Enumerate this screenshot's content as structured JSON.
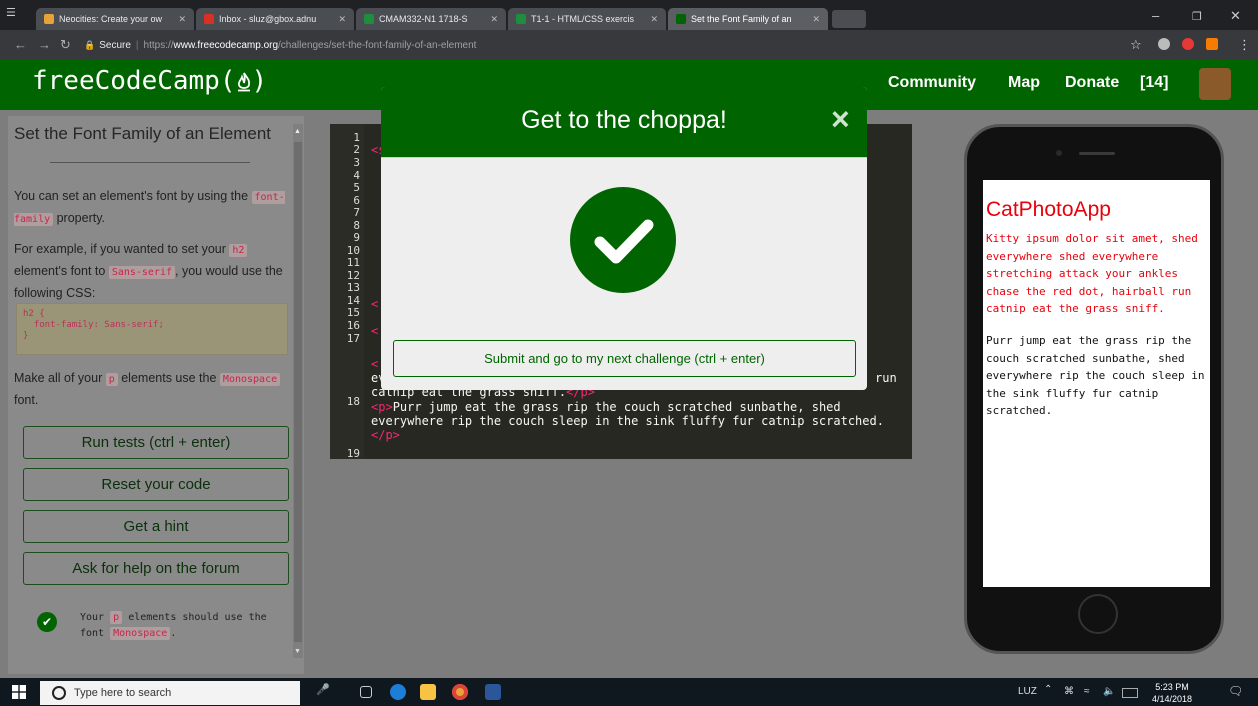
{
  "browser": {
    "tabs": [
      {
        "label": "Neocities: Create your ow",
        "favicon_color": "#e8a23a"
      },
      {
        "label": "Inbox - sluz@gbox.adnu",
        "favicon_color": "#d93025"
      },
      {
        "label": "CMAM332-N1 1718-S",
        "favicon_color": "#1e8e3e"
      },
      {
        "label": "T1-1 - HTML/CSS exercis",
        "favicon_color": "#1e8e3e"
      },
      {
        "label": "Set the Font Family of an",
        "favicon_color": "#006400"
      }
    ],
    "secure_label": "Secure",
    "url_scheme": "https://",
    "url_host": "www.freecodecamp.org",
    "url_path": "/challenges/set-the-font-family-of-an-element"
  },
  "navbar": {
    "logo": "freeCodeCamp(🔥)",
    "logo_text": "freeCodeCamp(",
    "logo_close": ")",
    "links": [
      "Community",
      "Map",
      "Donate"
    ],
    "points": "[14]"
  },
  "challenge": {
    "title": "Set the Font Family of an Element",
    "p1_before": "You can set an element's font by using the",
    "p1_code": "font-family",
    "p1_after": "property.",
    "p2_a": "For example, if you wanted to set your",
    "p2_code1": "h2",
    "p2_b": "element's font to",
    "p2_code2": "Sans-serif",
    "p2_c": ", you would use the following CSS:",
    "example_lines": [
      "h2 {",
      "  font-family: Sans-serif;",
      "}"
    ],
    "p3_a": "Make all of your",
    "p3_code1": "p",
    "p3_b": "elements use the",
    "p3_code2": "Monospace",
    "p3_c": "font.",
    "buttons": {
      "run": "Run tests (ctrl + enter)",
      "reset": "Reset your code",
      "hint": "Get a hint",
      "forum": "Ask for help on the forum"
    },
    "test_a": "Your",
    "test_code1": "p",
    "test_b": "elements should use the font",
    "test_code2": "Monospace",
    "test_c": "."
  },
  "editor": {
    "line_numbers": [
      "1",
      "2",
      "3",
      "4",
      "5",
      "6",
      "7",
      "8",
      "9",
      "10",
      "11",
      "12",
      "13",
      "14",
      "15",
      "16",
      "17",
      "18",
      "19"
    ],
    "line2_visible": "<s",
    "line13_visible": "<",
    "line15_visible": "<",
    "line17_visible": "<",
    "line17b_left": "ev",
    "line17b_right": "run",
    "line17c": "catnip eat the grass sniff.",
    "line17c_tag": "</p>",
    "line18_open": "<p>",
    "line18_text": "Purr jump eat the grass rip the couch scratched sunbathe, shed",
    "line18_text2": "everywhere rip the couch sleep in the sink fluffy fur catnip scratched.",
    "line18_close": "</p>"
  },
  "preview": {
    "title": "CatPhotoApp",
    "p1": "Kitty ipsum dolor sit amet, shed everywhere shed everywhere stretching attack your ankles chase the red dot, hairball run catnip eat the grass sniff.",
    "p2": "Purr jump eat the grass rip the couch scratched sunbathe, shed everywhere rip the couch sleep in the sink fluffy fur catnip scratched.",
    "p1_color": "#e8000b"
  },
  "modal": {
    "title": "Get to the choppa!",
    "close_glyph": "×",
    "submit_label": "Submit and go to my next challenge (ctrl + enter)"
  },
  "taskbar": {
    "search_placeholder": "Type here to search",
    "tray_lang": "LUZ",
    "time": "5:23 PM",
    "date": "4/14/2018"
  },
  "colors": {
    "fcc_green": "#006400",
    "overlay_gray": "#7d7d7d",
    "editor_bg": "#272822",
    "code_tag": "#f92672"
  }
}
